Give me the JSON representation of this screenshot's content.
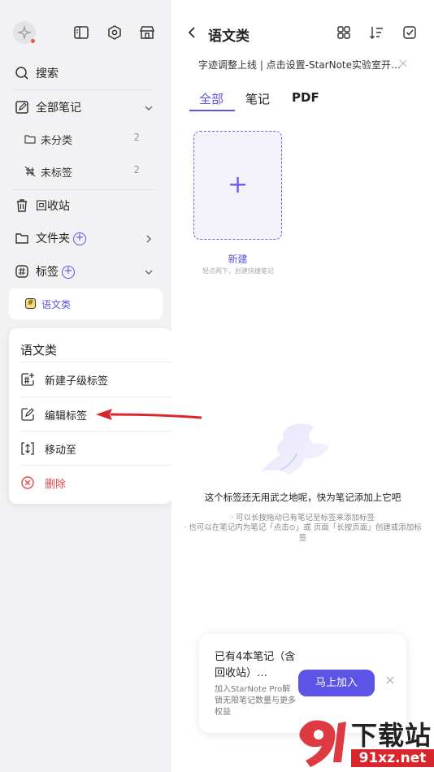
{
  "sidebar": {
    "search_label": "搜索",
    "all_notes_label": "全部笔记",
    "uncategorized": {
      "label": "未分类",
      "count": "2"
    },
    "untagged": {
      "label": "未标签",
      "count": "2"
    },
    "trash_label": "回收站",
    "folders_label": "文件夹",
    "tags_label": "标签",
    "tag_item_label": "语文类",
    "tag_hash": "#"
  },
  "context_menu": {
    "title": "语文类",
    "items": [
      {
        "label": "新建子级标签",
        "icon": "subtag-add-icon"
      },
      {
        "label": "编辑标签",
        "icon": "edit-icon"
      },
      {
        "label": "移动至",
        "icon": "move-icon"
      },
      {
        "label": "删除",
        "icon": "delete-icon",
        "color": "#e5484d"
      }
    ]
  },
  "main": {
    "title": "语文类",
    "notice": "字迹调整上线 | 点击设置-StarNote实验室开…",
    "tabs": [
      "全部",
      "笔记",
      "PDF"
    ],
    "active_tab": "全部",
    "new_card_label": "新建",
    "new_card_hint": "轻点两下，创建快捷笔记",
    "empty_main": "这个标签还无用武之地呢，快为笔记添加上它吧",
    "empty_sub1": "· 可以长按拖动已有笔记至标签来添加标签",
    "empty_sub2_line1": "· 也可以在笔记内为笔记「点击⊙」或 页面「长按页面」创建或添加标",
    "empty_sub2_line2": "签"
  },
  "promo": {
    "title": "已有4本笔记（含回收站）…",
    "desc": "加入StarNote Pro解锁无限笔记数量与更多权益",
    "button": "马上加入"
  },
  "watermark": {
    "text": "下载站",
    "url_text": "91xz.net"
  },
  "colors": {
    "accent": "#5b54e6",
    "danger": "#e5484d",
    "sidebar_bg": "#f2f2f4",
    "arrow": "#d9262c"
  }
}
